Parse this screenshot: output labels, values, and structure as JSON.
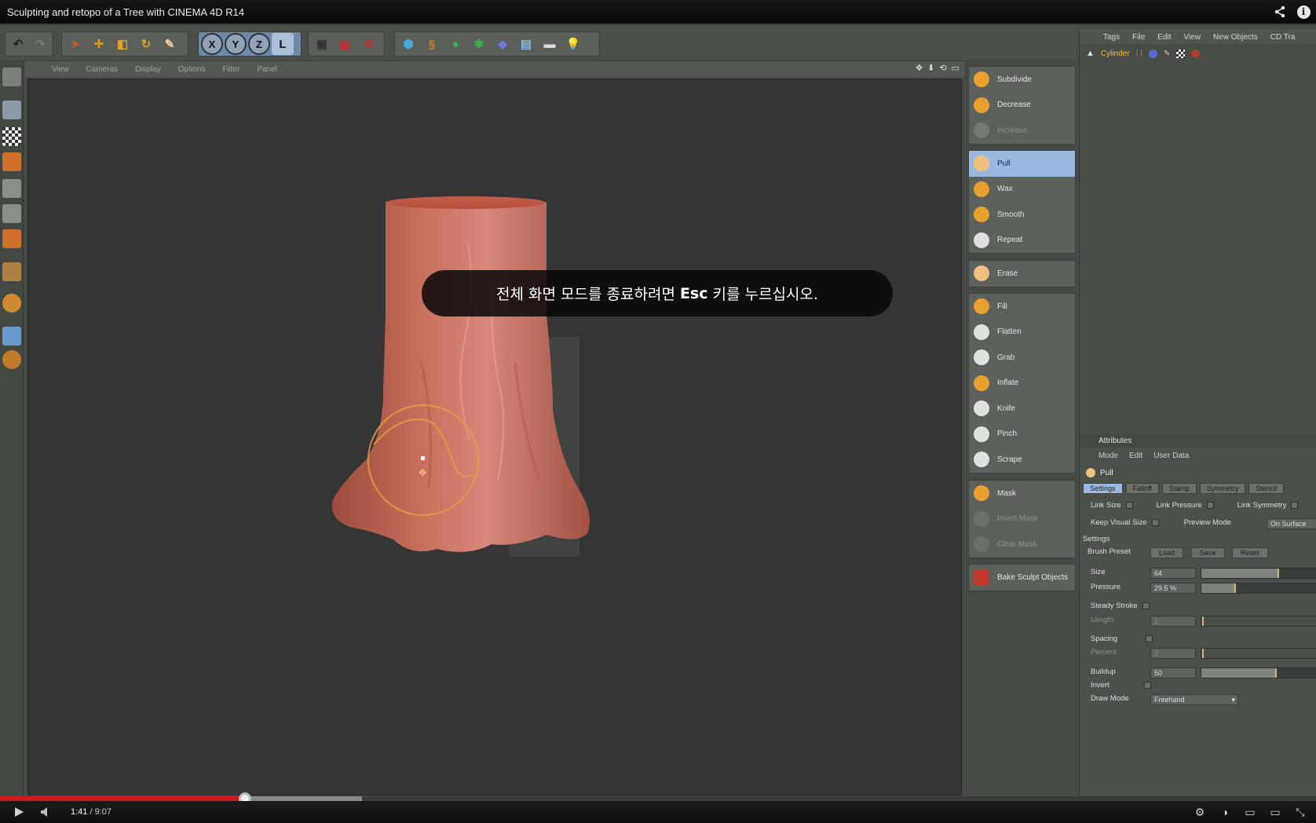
{
  "player": {
    "title": "Sculpting and retopo of a Tree with CINEMA 4D R14",
    "current_time": "1:41",
    "duration": "/ 9:07",
    "played_fraction": 0.186,
    "loaded_fraction": 0.275,
    "fullscreen_notice": {
      "before": "전체 화면 모드를 종료하려면",
      "key": "Esc",
      "after": "키를 누르십시오."
    },
    "colors": {
      "progress_played": "#cc181e",
      "progress_loaded": "#8a8a8a"
    }
  },
  "viewport": {
    "menu": [
      "View",
      "Cameras",
      "Display",
      "Options",
      "Filter",
      "Panel"
    ]
  },
  "sculpt_palette": {
    "group1": [
      {
        "label": "Subdivide",
        "icon": "subdivide-icon"
      },
      {
        "label": "Decrease",
        "icon": "decrease-icon"
      },
      {
        "label": "Increase",
        "icon": "increase-icon",
        "dim": true
      }
    ],
    "group2": [
      {
        "label": "Pull",
        "icon": "pull-brush-icon",
        "selected": true
      },
      {
        "label": "Wax",
        "icon": "wax-brush-icon"
      },
      {
        "label": "Smooth",
        "icon": "smooth-brush-icon"
      },
      {
        "label": "Repeat",
        "icon": "repeat-brush-icon"
      }
    ],
    "group3": [
      {
        "label": "Erase",
        "icon": "erase-brush-icon"
      }
    ],
    "group4": [
      {
        "label": "Fill",
        "icon": "fill-brush-icon"
      },
      {
        "label": "Flatten",
        "icon": "flatten-brush-icon"
      },
      {
        "label": "Grab",
        "icon": "grab-brush-icon"
      },
      {
        "label": "Inflate",
        "icon": "inflate-brush-icon"
      },
      {
        "label": "Knife",
        "icon": "knife-brush-icon"
      },
      {
        "label": "Pinch",
        "icon": "pinch-brush-icon"
      },
      {
        "label": "Scrape",
        "icon": "scrape-brush-icon"
      }
    ],
    "group5": [
      {
        "label": "Mask",
        "icon": "mask-brush-icon"
      },
      {
        "label": "Invert Mask",
        "icon": "invert-mask-icon",
        "dim": true
      },
      {
        "label": "Clear Mask",
        "icon": "clear-mask-icon",
        "dim": true
      }
    ],
    "group6": [
      {
        "label": "Bake Sculpt Objects",
        "icon": "bake-sculpt-icon"
      }
    ]
  },
  "object_manager": {
    "menu": [
      "Tags",
      "File",
      "Edit",
      "View",
      "New Objects",
      "CD Tra"
    ],
    "object_name": "Cylinder"
  },
  "attribute_manager": {
    "title": "Attributes",
    "menu": [
      "Mode",
      "Edit",
      "User Data"
    ],
    "object": "Pull",
    "tabs": [
      "Settings",
      "Falloff",
      "Stamp",
      "Symmetry",
      "Stencil"
    ],
    "link_size": "Link Size",
    "link_pressure": "Link Pressure",
    "link_symmetry": "Link Symmetry",
    "keep_visual_size": "Keep Visual Size",
    "preview_mode": "Preview Mode",
    "preview_mode_value": "On Surface",
    "settings_header": "Settings",
    "brush_preset": "Brush Preset",
    "load": "Load",
    "save": "Save",
    "reset": "Reset",
    "size_label": "Size",
    "size_value": "64",
    "size_fraction": 0.68,
    "pressure_label": "Pressure",
    "pressure_value": "29.5 %",
    "pressure_fraction": 0.3,
    "steady_stroke": "Steady Stroke",
    "length_label": "Length",
    "length_value": "2",
    "spacing": "Spacing",
    "percent_label": "Percent",
    "percent_value": "2",
    "buildup_label": "Buildup",
    "buildup_value": "50",
    "buildup_fraction": 0.66,
    "invert": "Invert",
    "draw_mode": "Draw Mode",
    "draw_mode_value": "Freehand"
  }
}
